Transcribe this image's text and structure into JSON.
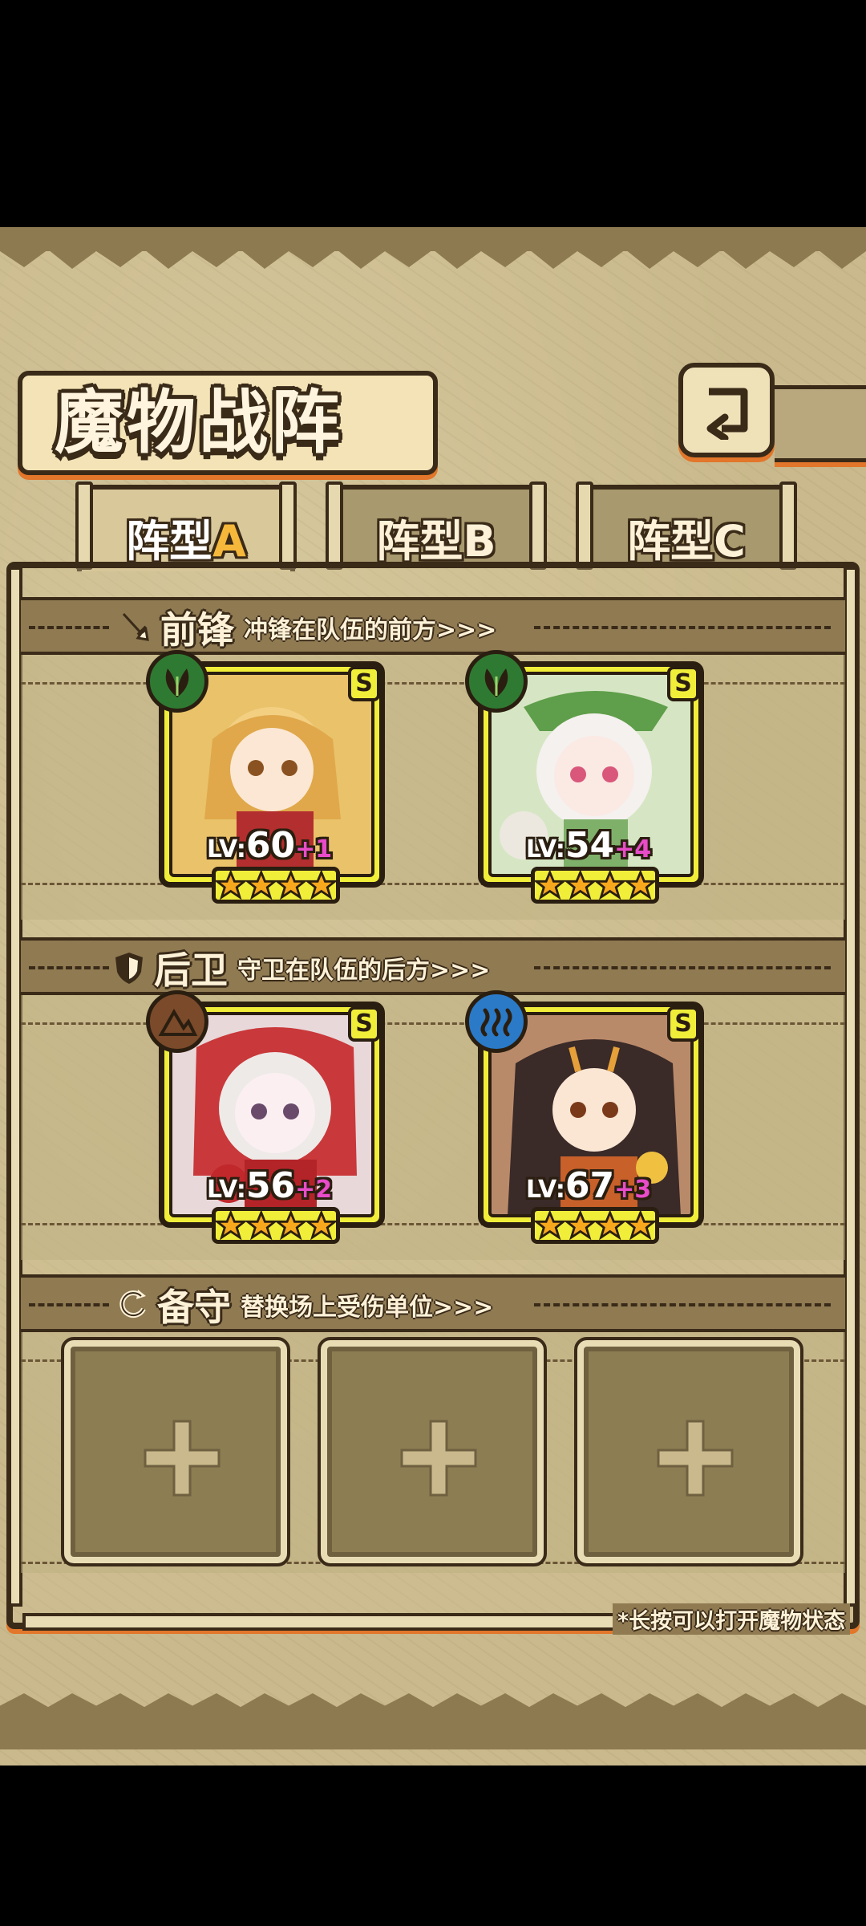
{
  "header": {
    "title": "魔物战阵",
    "back_icon": "back-arrow-icon"
  },
  "tabs": [
    {
      "prefix": "阵型",
      "letter": "A",
      "active": true
    },
    {
      "prefix": "阵型",
      "letter": "B",
      "active": false
    },
    {
      "prefix": "阵型",
      "letter": "C",
      "active": false
    }
  ],
  "sections": {
    "vanguard": {
      "title": "前锋",
      "desc": "冲锋在队伍的前方>>>",
      "icon": "sword-icon"
    },
    "rearguard": {
      "title": "后卫",
      "desc": "守卫在队伍的后方>>>",
      "icon": "shield-icon"
    },
    "reserve": {
      "title": "备守",
      "desc": "替换场上受伤单位>>>",
      "icon": "swap-icon"
    }
  },
  "units": [
    {
      "rank": "S",
      "element": "leaf-icon",
      "element_color": "#2f7a32",
      "lv_prefix": "LV:",
      "level": "60",
      "bonus": "+1",
      "stars": 4
    },
    {
      "rank": "S",
      "element": "leaf-icon",
      "element_color": "#2f7a32",
      "lv_prefix": "LV:",
      "level": "54",
      "bonus": "+4",
      "stars": 4
    },
    {
      "rank": "S",
      "element": "earth-icon",
      "element_color": "#7a4a2a",
      "lv_prefix": "LV:",
      "level": "56",
      "bonus": "+2",
      "stars": 4
    },
    {
      "rank": "S",
      "element": "water-icon",
      "element_color": "#2a7ac8",
      "lv_prefix": "LV:",
      "level": "67",
      "bonus": "+3",
      "stars": 4
    }
  ],
  "reserve_slots": 3,
  "hint": "*长按可以打开魔物状态",
  "colors": {
    "frame": "#3a2a18",
    "accent": "#e2762a",
    "card_yellow": "#f1ee3a",
    "bonus_pink": "#e84cc8"
  }
}
